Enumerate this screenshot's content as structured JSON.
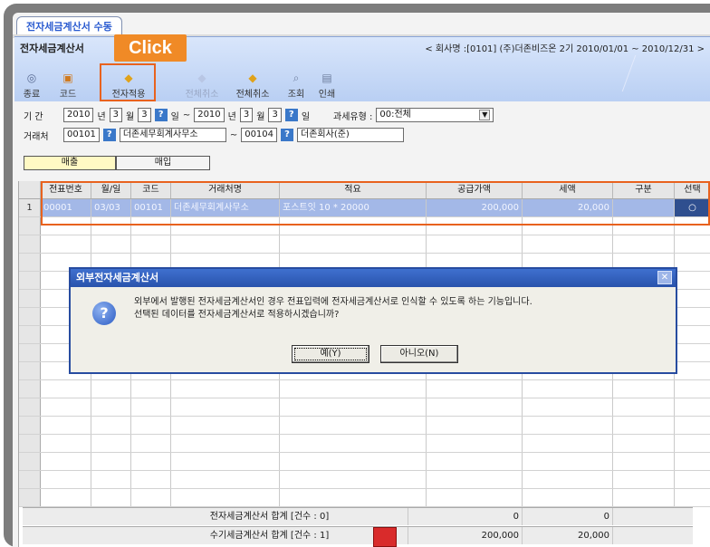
{
  "tab": {
    "label": "전자세금계산서 수동"
  },
  "header": {
    "title": "전자세금계산서",
    "company": "< 회사명 :[0101] (주)더존비즈온 2기 2010/01/01 ~ 2010/12/31 >"
  },
  "toolbar": {
    "buttons": [
      {
        "label": "종료",
        "icon": "close-icon"
      },
      {
        "label": "코드",
        "icon": "code-icon"
      },
      {
        "label": "전자적용",
        "icon": "apply-icon"
      },
      {
        "label": "전체취소",
        "icon": "cancel-icon",
        "disabled": true
      },
      {
        "label": "전체취소",
        "icon": "cancel-all-icon"
      },
      {
        "label": "조회",
        "icon": "search-icon"
      },
      {
        "label": "인쇄",
        "icon": "print-icon"
      }
    ]
  },
  "callout": {
    "label": "Click"
  },
  "filters": {
    "period_label": "기   간",
    "year_from": "2010",
    "month_from": "3",
    "day_from": "3",
    "year_to": "2010",
    "month_to": "3",
    "day_to": "3",
    "unit_year": "년",
    "unit_month": "월",
    "unit_day": "일",
    "range_sep": "~",
    "tax_type_label": "과세유형 :",
    "tax_type_value": "00:전체",
    "partner_label": "거래처",
    "partner_from_code": "00101",
    "partner_from_name": "더존세무회계사무소",
    "partner_to_code": "00104",
    "partner_to_name": "더존회사(준)",
    "sales_label": "매출",
    "purchase_label": "매입"
  },
  "grid": {
    "columns": [
      "전표번호",
      "월/일",
      "코드",
      "거래처명",
      "적요",
      "공급가액",
      "세액",
      "구분",
      "선택"
    ],
    "rows": [
      {
        "num": "1",
        "slip": "00001",
        "date": "03/03",
        "code": "00101",
        "partner": "더존세무회계사무소",
        "memo": "포스트잇 10 * 20000",
        "supply": "200,000",
        "tax": "20,000",
        "type": "",
        "select": "○"
      }
    ]
  },
  "dialog": {
    "title": "외부전자세금계산서",
    "line1": "외부에서 발행된 전자세금계산서인 경우 전표입력에 전자세금계산서로 인식할 수 있도록 하는 기능입니다.",
    "line2": "선택된 데이터를 전자세금계산서로 적용하시겠습니까?",
    "yes": "예(Y)",
    "no": "아니오(N)"
  },
  "totals": {
    "electronic_label": "전자세금계산서 합계 [건수 : 0]",
    "electronic_supply": "0",
    "electronic_tax": "0",
    "manual_label": "수기세금계산서 합계 [건수 : 1]",
    "manual_supply": "200,000",
    "manual_tax": "20,000"
  },
  "colors": {
    "highlight": "#e8621e",
    "callout": "#f08a26",
    "selected_row": "#a3b8e7",
    "dialog_title": "#2953ac"
  }
}
